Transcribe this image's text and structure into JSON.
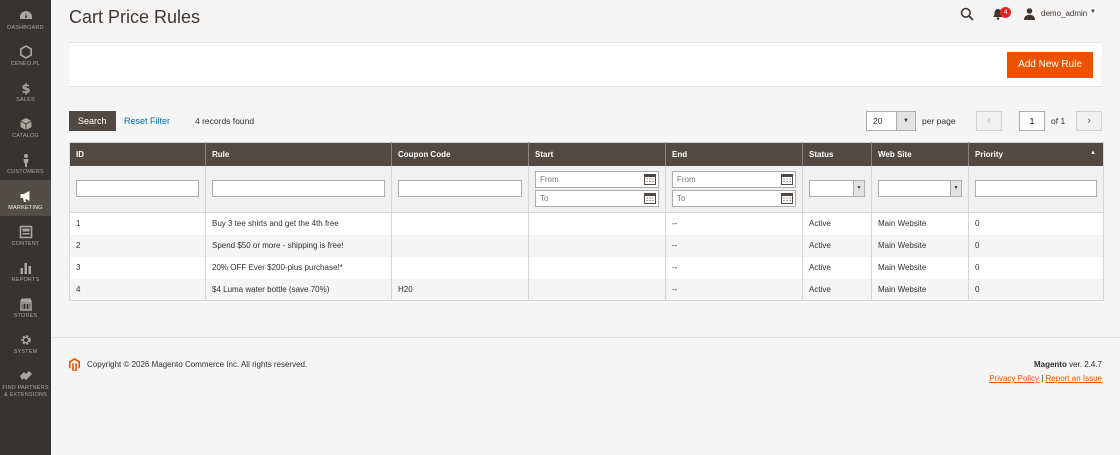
{
  "sidebar": {
    "items": [
      {
        "label": "DASHBOARD",
        "icon": "dashboard-icon"
      },
      {
        "label": "CENEO.PL",
        "icon": "hexagon-icon"
      },
      {
        "label": "SALES",
        "icon": "dollar-icon"
      },
      {
        "label": "CATALOG",
        "icon": "box-icon"
      },
      {
        "label": "CUSTOMERS",
        "icon": "person-icon"
      },
      {
        "label": "MARKETING",
        "icon": "megaphone-icon"
      },
      {
        "label": "CONTENT",
        "icon": "content-icon"
      },
      {
        "label": "REPORTS",
        "icon": "bar-chart-icon"
      },
      {
        "label": "STORES",
        "icon": "store-icon"
      },
      {
        "label": "SYSTEM",
        "icon": "gear-icon"
      },
      {
        "label": "FIND PARTNERS & EXTENSIONS",
        "icon": "extensions-icon"
      }
    ],
    "active": "MARKETING"
  },
  "header": {
    "title": "Cart Price Rules",
    "notification_count": "4",
    "username": "demo_admin"
  },
  "actions": {
    "add_rule_label": "Add New Rule"
  },
  "controls": {
    "search_label": "Search",
    "reset_label": "Reset Filter",
    "records_found": "4 records found",
    "per_page_value": "20",
    "per_page_label": "per page",
    "page_value": "1",
    "of_pages": "of 1"
  },
  "grid": {
    "columns": [
      "ID",
      "Rule",
      "Coupon Code",
      "Start",
      "End",
      "Status",
      "Web Site",
      "Priority"
    ],
    "filter_from_placeholder": "From",
    "filter_to_placeholder": "To",
    "rows": [
      {
        "id": "1",
        "rule": "Buy 3 tee shirts and get the 4th free",
        "coupon": "",
        "start": "",
        "end": "--",
        "status": "Active",
        "website": "Main Website",
        "priority": "0"
      },
      {
        "id": "2",
        "rule": "Spend $50 or more - shipping is free!",
        "coupon": "",
        "start": "",
        "end": "--",
        "status": "Active",
        "website": "Main Website",
        "priority": "0"
      },
      {
        "id": "3",
        "rule": "20% OFF Ever $200-plus purchase!*",
        "coupon": "",
        "start": "",
        "end": "--",
        "status": "Active",
        "website": "Main Website",
        "priority": "0"
      },
      {
        "id": "4",
        "rule": "$4 Luma water bottle (save 70%)",
        "coupon": "H20",
        "start": "",
        "end": "--",
        "status": "Active",
        "website": "Main Website",
        "priority": "0"
      }
    ]
  },
  "footer": {
    "copyright": "Copyright © 2026 Magento Commerce Inc. All rights reserved.",
    "brand": "Magento",
    "version": " ver. 2.4.7",
    "privacy_label": "Privacy Policy",
    "separator": " | ",
    "report_label": "Report an Issue"
  },
  "colors": {
    "accent": "#eb5202",
    "sidebar_bg": "#373330",
    "header_bg": "#514943",
    "link": "#006bb4"
  }
}
